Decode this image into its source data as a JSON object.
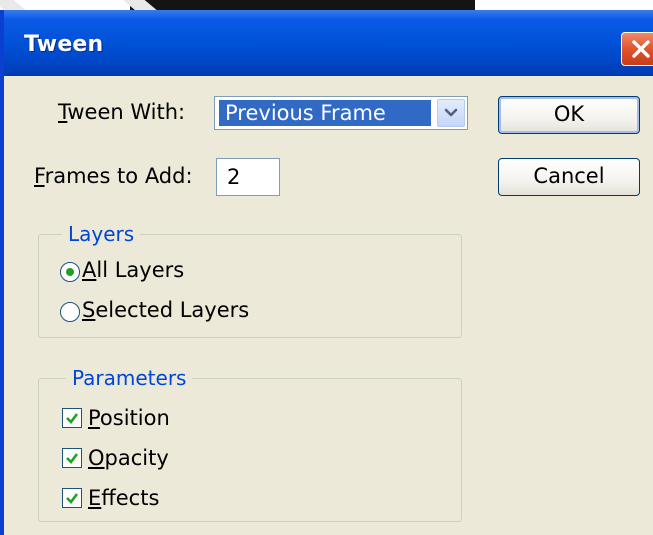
{
  "window": {
    "title": "Tween",
    "close_icon": "close-icon"
  },
  "tween_with": {
    "label_accel": "T",
    "label_rest": "ween With:",
    "value": "Previous Frame"
  },
  "frames_to_add": {
    "label_accel": "F",
    "label_rest": "rames to Add:",
    "value": "2"
  },
  "buttons": {
    "ok": "OK",
    "cancel": "Cancel"
  },
  "layers": {
    "legend": "Layers",
    "options": [
      {
        "accel": "A",
        "rest": "ll Layers",
        "selected": true
      },
      {
        "accel": "S",
        "rest": "elected Layers",
        "selected": false
      }
    ]
  },
  "parameters": {
    "legend": "Parameters",
    "options": [
      {
        "accel": "P",
        "rest": "osition",
        "checked": true
      },
      {
        "accel": "O",
        "rest": "pacity",
        "checked": true
      },
      {
        "accel": "E",
        "rest": "ffects",
        "checked": true
      }
    ]
  },
  "colors": {
    "titlebar": "#0051d8",
    "dialog_bg": "#ece9d8",
    "groupbox_legend": "#0046d5",
    "selection": "#316ac5",
    "check_mark": "#21a121"
  }
}
